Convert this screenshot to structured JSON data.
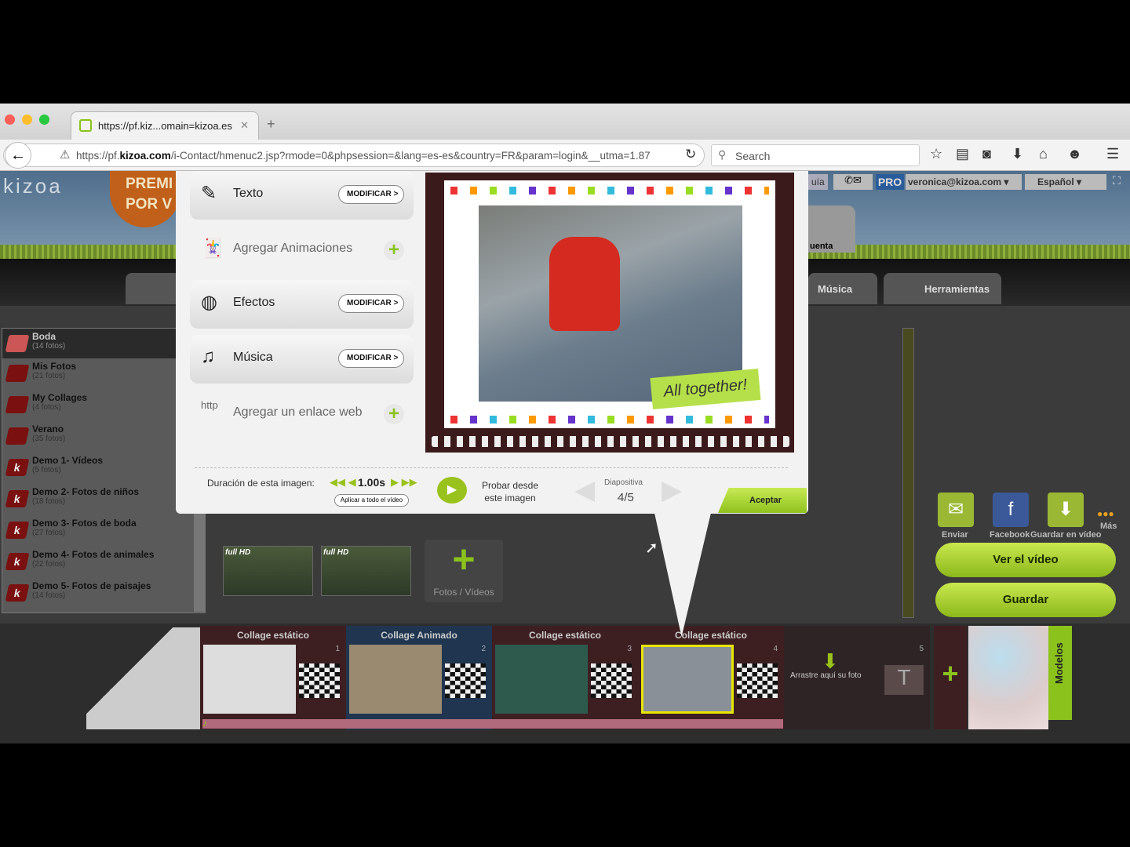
{
  "browser": {
    "tab_title": "https://pf.kiz...omain=kizoa.es",
    "url_prefix": "https://pf.",
    "url_domain": "kizoa.com",
    "url_rest": "/i-Contact/hmenuc2.jsp?rmode=0&phpsession=&lang=es-es&country=FR&param=login&__utma=1.87",
    "search_placeholder": "Search"
  },
  "header": {
    "logo": "kizoa",
    "promo": "PREMI POR V",
    "help": "uía",
    "pro": "PRO",
    "account": "veronica@kizoa.com",
    "language": "Español",
    "account_tab": "uenta"
  },
  "nav_tabs": [
    "Música",
    "Herramientas"
  ],
  "sidebar": {
    "albums": [
      {
        "name": "Boda",
        "count": "(14 fotos)"
      },
      {
        "name": "Mis Fotos",
        "count": "(21 fotos)"
      },
      {
        "name": "My Collages",
        "count": "(4 fotos)"
      },
      {
        "name": "Verano",
        "count": "(35 fotos)"
      },
      {
        "name": "Demo 1- Vídeos",
        "count": "(5 fotos)"
      },
      {
        "name": "Demo 2- Fotos de niños",
        "count": "(18 fotos)"
      },
      {
        "name": "Demo 3- Fotos de boda",
        "count": "(27 fotos)"
      },
      {
        "name": "Demo 4- Fotos de animales",
        "count": "(22 fotos)"
      },
      {
        "name": "Demo 5- Fotos de paisajes",
        "count": "(14 fotos)"
      }
    ]
  },
  "modal": {
    "menu": [
      {
        "label": "Texto",
        "action": "MODIFICAR >"
      },
      {
        "label": "Agregar Animaciones",
        "action": "+"
      },
      {
        "label": "Efectos",
        "action": "MODIFICAR >"
      },
      {
        "label": "Música",
        "action": "MODIFICAR >"
      },
      {
        "label": "Agregar un enlace web",
        "action": "+",
        "icon_text": "http"
      }
    ],
    "sticker": "All together!",
    "duration_label": "Duración de esta imagen:",
    "duration": "1.00s",
    "apply_all": "Aplicar a todo el vídeo",
    "test_from": "Probar desde este imagen",
    "slide_label": "Diapositiva",
    "slide": "4/5",
    "accept": "Aceptar"
  },
  "media": {
    "thumbs": [
      "full HD",
      "full HD"
    ],
    "add_label": "Fotos / Vídeos"
  },
  "share": {
    "items": [
      "Enviar",
      "Facebook",
      "Guardar en vídeo"
    ],
    "more": "Más",
    "view": "Ver el vídeo",
    "save": "Guardar"
  },
  "timeline": {
    "slots": [
      {
        "title": "Collage estático",
        "num": "1"
      },
      {
        "title": "Collage Animado",
        "num": "2"
      },
      {
        "title": "Collage estático",
        "num": "3"
      },
      {
        "title": "Collage estático",
        "num": "4"
      },
      {
        "title": "Arrastre aquí su foto",
        "num": "5"
      }
    ],
    "models": "Modelos"
  }
}
